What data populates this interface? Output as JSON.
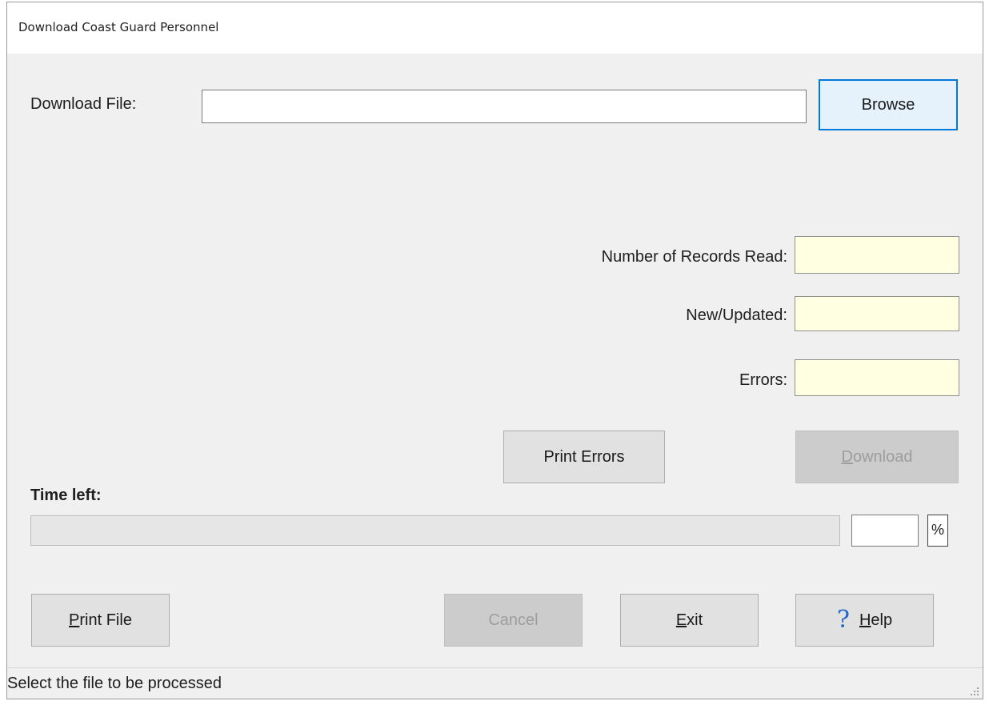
{
  "window": {
    "title": "Download Coast Guard Personnel"
  },
  "download_file": {
    "label": "Download File:",
    "value": "",
    "browse_label": "Browse"
  },
  "stats": {
    "records_read": {
      "label": "Number of Records Read:",
      "value": ""
    },
    "new_updated": {
      "label": "New/Updated:",
      "value": ""
    },
    "errors": {
      "label": "Errors:",
      "value": ""
    }
  },
  "actions": {
    "print_errors": "Print Errors",
    "download": "Download"
  },
  "progress": {
    "label": "Time left:",
    "percent_value": "",
    "percent_symbol": "%",
    "fraction": 0
  },
  "footer_buttons": {
    "print_file": "Print File",
    "cancel": "Cancel",
    "exit": "Exit",
    "help": "Help",
    "help_icon": "?"
  },
  "status": {
    "text": "Select the file to be processed"
  }
}
